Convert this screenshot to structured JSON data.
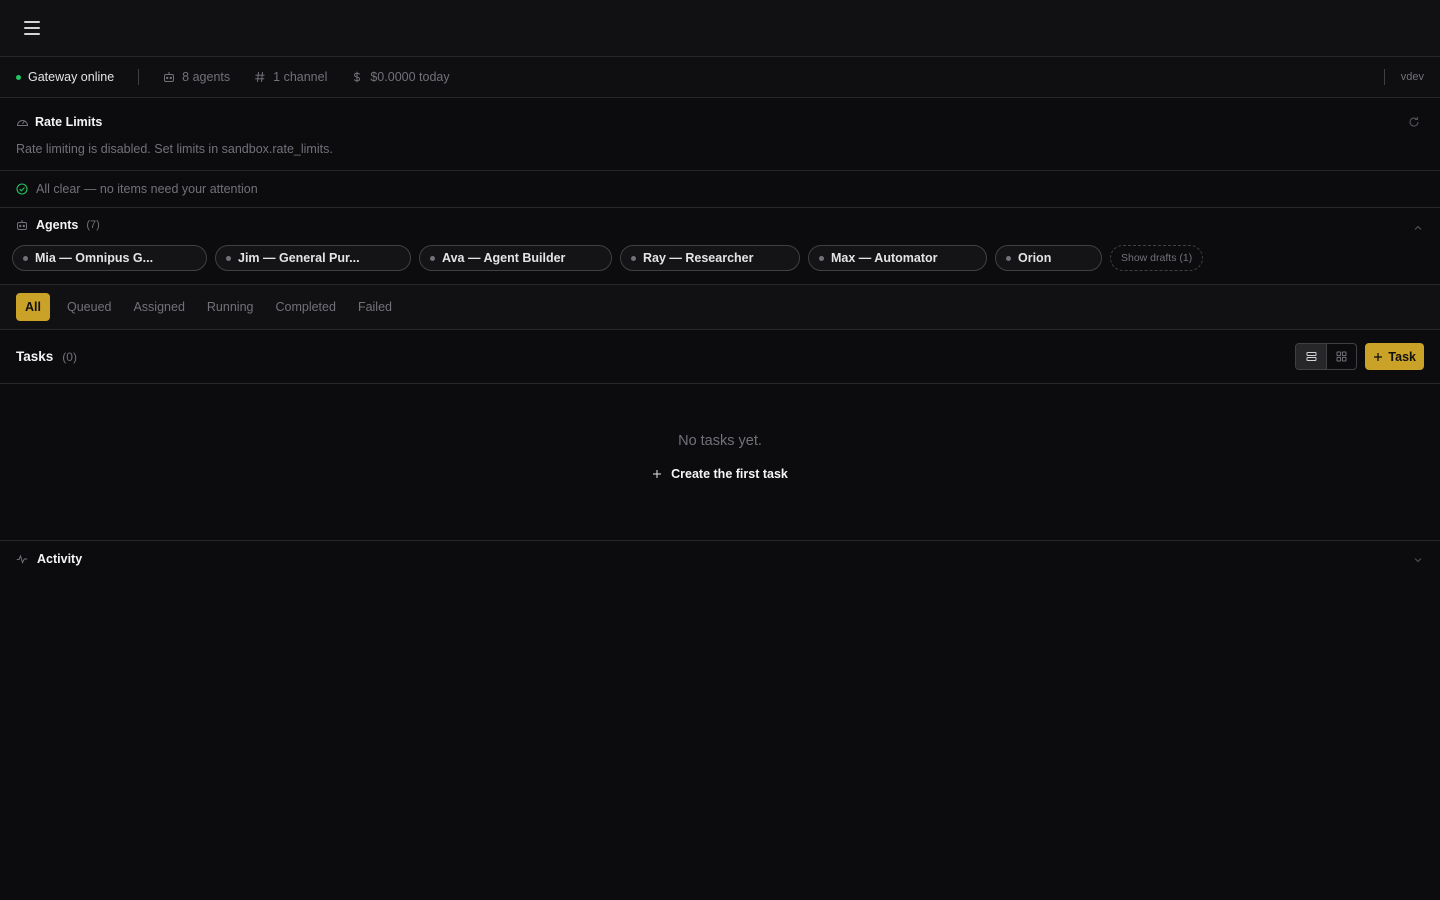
{
  "status": {
    "gateway": "Gateway online",
    "agents": "8 agents",
    "channels": "1 channel",
    "cost": "$0.0000 today",
    "version": "vdev"
  },
  "rate_limits": {
    "title": "Rate Limits",
    "message": "Rate limiting is disabled. Set limits in sandbox.rate_limits."
  },
  "attention": {
    "message": "All clear — no items need your attention"
  },
  "agents": {
    "title": "Agents",
    "count": "(7)",
    "items": [
      {
        "label": "Mia — Omnipus G..."
      },
      {
        "label": "Jim — General Pur..."
      },
      {
        "label": "Ava — Agent Builder"
      },
      {
        "label": "Ray — Researcher"
      },
      {
        "label": "Max — Automator"
      },
      {
        "label": "Orion"
      }
    ],
    "drafts_label": "Show drafts (1)"
  },
  "filters": {
    "tabs": [
      {
        "label": "All"
      },
      {
        "label": "Queued"
      },
      {
        "label": "Assigned"
      },
      {
        "label": "Running"
      },
      {
        "label": "Completed"
      },
      {
        "label": "Failed"
      }
    ],
    "selected": "All"
  },
  "tasks": {
    "title": "Tasks",
    "count": "(0)",
    "add_label": "Task",
    "empty_message": "No tasks yet.",
    "create_first_label": "Create the first task"
  },
  "activity": {
    "title": "Activity"
  },
  "colors": {
    "accent": "#c9a227",
    "online": "#22c55e",
    "background": "#0c0c0e"
  },
  "icons": {
    "menu": "hamburger-icon",
    "agents": "robot-icon",
    "channels": "hash-icon",
    "cost": "dollar-icon",
    "rate_limits": "gauge-icon",
    "refresh": "refresh-icon",
    "all_clear": "check-circle-icon",
    "activity": "pulse-icon"
  }
}
